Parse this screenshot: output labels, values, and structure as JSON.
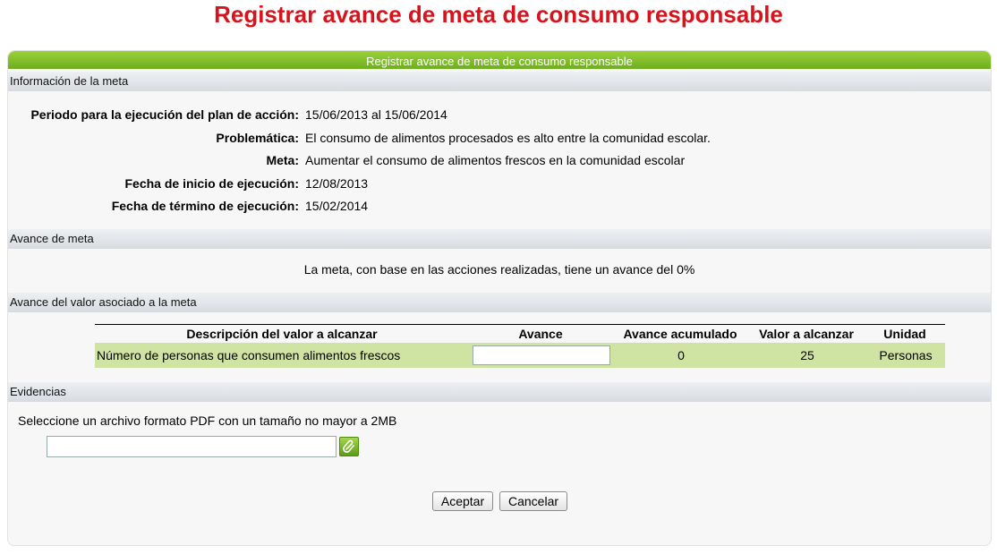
{
  "page_title": "Registrar avance de meta de consumo responsable",
  "panel": {
    "header": "Registrar avance de meta de consumo responsable",
    "sections": {
      "info": "Información de la meta",
      "avance": "Avance de meta",
      "valor": "Avance del valor asociado a la meta",
      "evidencias": "Evidencias"
    }
  },
  "info": [
    {
      "label": "Periodo para la ejecución del plan de acción:",
      "value": "15/06/2013 al 15/06/2014"
    },
    {
      "label": "Problemática:",
      "value": "El consumo de alimentos procesados es alto entre la comunidad escolar."
    },
    {
      "label": "Meta:",
      "value": "Aumentar el consumo de alimentos frescos en la comunidad escolar"
    },
    {
      "label": "Fecha de inicio de ejecución:",
      "value": "12/08/2013"
    },
    {
      "label": "Fecha de término de ejecución:",
      "value": "15/02/2014"
    }
  ],
  "avance_text": "La meta, con base en las acciones realizadas, tiene un avance del 0%",
  "table": {
    "headers": [
      "Descripción del valor a alcanzar",
      "Avance",
      "Avance acumulado",
      "Valor a alcanzar",
      "Unidad"
    ],
    "row": {
      "descripcion": "Número de personas que consumen alimentos frescos",
      "avance": "",
      "acumulado": "0",
      "valor": "25",
      "unidad": "Personas"
    }
  },
  "evidencias": {
    "instruction": "Seleccione un archivo formato PDF con un tamaño no mayor a 2MB",
    "file_value": ""
  },
  "buttons": {
    "accept": "Aceptar",
    "cancel": "Cancelar"
  },
  "icons": {
    "attach": "paperclip-icon"
  },
  "colors": {
    "title": "#d7141c",
    "header": "#7cbf28",
    "row": "#cfe4a3"
  }
}
